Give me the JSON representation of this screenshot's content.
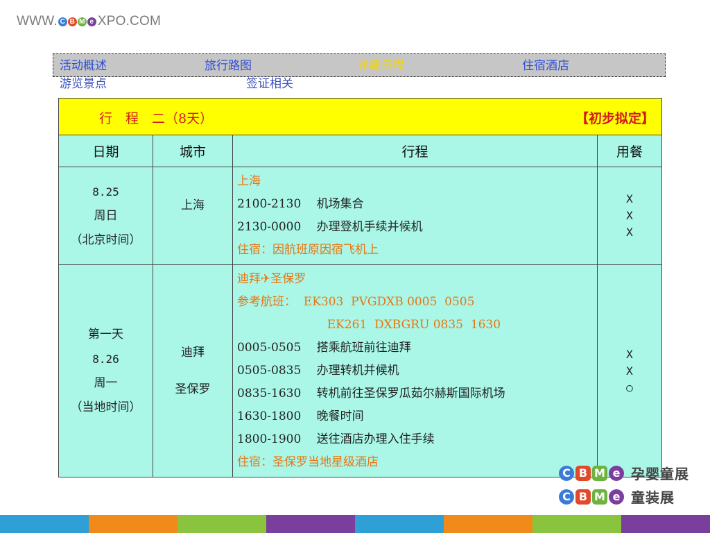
{
  "header": {
    "url_prefix": "WWW.",
    "url_brand": [
      "C",
      "B",
      "M",
      "e"
    ],
    "url_suffix": "XPO.COM"
  },
  "nav": {
    "row1": [
      {
        "label": "活动概述",
        "active": false
      },
      {
        "label": "旅行路图",
        "active": false
      },
      {
        "label": "详细日程",
        "active": true
      },
      {
        "label": "住宿酒店",
        "active": false
      }
    ],
    "row2": [
      {
        "label": "游览景点"
      },
      {
        "label": "签证相关"
      }
    ]
  },
  "table": {
    "title": "行　程　二（8天）",
    "note": "【初步拟定】",
    "headers": [
      "日期",
      "城市",
      "行程",
      "用餐"
    ],
    "days": [
      {
        "date": [
          "8.25",
          "周日",
          "（北京时间）"
        ],
        "city": [
          "上海"
        ],
        "plan": [
          {
            "text": "上海",
            "orange": true
          },
          {
            "text": "2100-2130　 机场集合",
            "orange": false
          },
          {
            "text": "2130-0000　 办理登机手续并候机",
            "orange": false
          },
          {
            "text": "住宿：因航班原因宿飞机上",
            "orange": true
          }
        ],
        "meals": [
          "X",
          "X",
          "X"
        ]
      },
      {
        "date": [
          "第一天",
          "8.26",
          "周一",
          "（当地时间）"
        ],
        "city": [
          "迪拜",
          "圣保罗"
        ],
        "plan": [
          {
            "text": "迪拜✈圣保罗",
            "orange": true
          },
          {
            "text": "参考航班：  EK303  PVGDXB 0005  0505",
            "orange": true
          },
          {
            "text": "                        EK261  DXBGRU 0835  1630",
            "orange": true
          },
          {
            "text": "0005-0505　 搭乘航班前往迪拜",
            "orange": false
          },
          {
            "text": "0505-0835　 办理转机并候机",
            "orange": false
          },
          {
            "text": "0835-1630　 转机前往圣保罗瓜茹尔赫斯国际机场",
            "orange": false
          },
          {
            "text": "1630-1800　 晚餐时间",
            "orange": false
          },
          {
            "text": "1800-1900　 送往酒店办理入住手续",
            "orange": false
          },
          {
            "text": "住宿：圣保罗当地星级酒店",
            "orange": true
          }
        ],
        "meals": [
          "X",
          "X",
          "○"
        ]
      }
    ]
  },
  "logos": [
    {
      "letters": [
        "C",
        "B",
        "M",
        "e"
      ],
      "label": "孕婴童展"
    },
    {
      "letters": [
        "C",
        "B",
        "M",
        "e"
      ],
      "label": "童装展"
    }
  ],
  "colors": {
    "brand": [
      "#3b7bd8",
      "#e04a2a",
      "#6db33f",
      "#7a3e9d"
    ],
    "bottom_bar": [
      "#2ea0d6",
      "#f08a1a",
      "#8ac43f",
      "#7a3e9d",
      "#2ea0d6",
      "#f08a1a",
      "#8ac43f",
      "#7a3e9d"
    ]
  }
}
